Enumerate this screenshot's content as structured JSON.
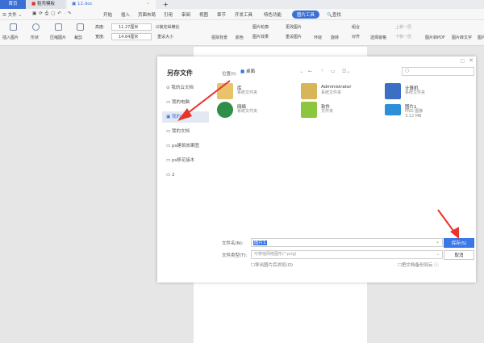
{
  "tabs": [
    {
      "label": "首页"
    },
    {
      "label": "稻壳模板"
    },
    {
      "label": "12.doc"
    }
  ],
  "new_tab": "+",
  "menu": {
    "file": "文件",
    "items": [
      "开始",
      "插入",
      "页面布局",
      "引用",
      "审阅",
      "视图",
      "章节",
      "开发工具",
      "特色功能"
    ],
    "active": "图片工具",
    "search": "查找"
  },
  "toolbar": {
    "insert_pic": "插入图片",
    "shape": "形状",
    "compress": "压缩图片",
    "crop": "裁剪",
    "height_label": "高度:",
    "height_value": "11.27厘米",
    "width_label": "宽度:",
    "width_value": "14.64厘米",
    "lock_ratio": "锁定纵横比",
    "reset_size": "重设大小",
    "remove_bg": "抠除背景",
    "color": "颜色",
    "outline": "图片轮廓",
    "effect": "图片效果",
    "change": "更改图片",
    "reset_pic": "重设图片",
    "wrap": "环绕",
    "rotate": "旋转",
    "group": "组合",
    "align": "对齐",
    "select_pane": "选择窗格",
    "up": "上移一层",
    "down": "下移一层",
    "to_pdf": "图片转PDF",
    "to_text": "图片转文字",
    "more": "图片"
  },
  "dialog": {
    "title": "另存文件",
    "location_label": "位置(I):",
    "location": "桌面",
    "sidebar": [
      {
        "label": "我的云文档"
      },
      {
        "label": "我的电脑"
      },
      {
        "label": "我的桌面",
        "selected": true
      },
      {
        "label": "我的文档"
      },
      {
        "label": "ps建筑效果图"
      },
      {
        "label": "ps移花接木"
      },
      {
        "label": "2"
      }
    ],
    "files": [
      {
        "name": "库",
        "type": "系统文件夹",
        "color": "#e8c36a"
      },
      {
        "name": "Administrator",
        "type": "系统文件夹",
        "color": "#d9b55a"
      },
      {
        "name": "计算机",
        "type": "系统文件夹",
        "color": "#3a6fc4"
      },
      {
        "name": "网络",
        "type": "系统文件夹",
        "color": "#2f8f4a"
      },
      {
        "name": "软件",
        "type": "文件夹",
        "color": "#8cc63f"
      },
      {
        "name": "图片1",
        "type": "PNG 图像",
        "size": "3.12 MB",
        "color": "#2c8fd8"
      }
    ],
    "filename_label": "文件名(N):",
    "filename_value": "图片1",
    "filetype_label": "文件类型(T):",
    "filetype_value": "可移植网络图形(*.png)",
    "open_after": "导出图片后浏览(O)",
    "backup": "把文档备份到云",
    "save": "保存(S)",
    "cancel": "取消"
  },
  "colors": {
    "accent": "#3b78e7",
    "arrow": "#e8332a",
    "active_tab": "#3b6fd4"
  }
}
